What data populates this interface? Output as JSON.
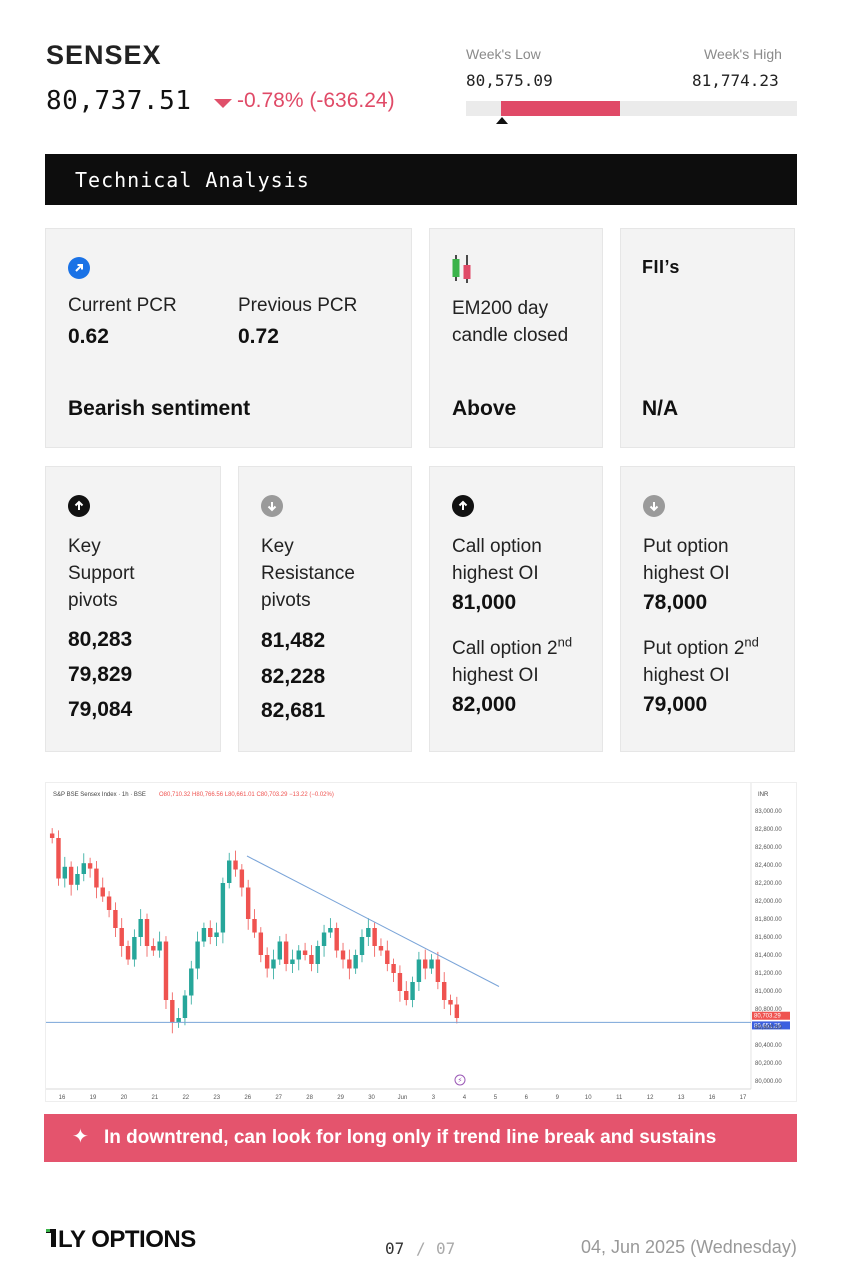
{
  "header": {
    "title": "SENSEX",
    "price": "80,737.51",
    "change_pct": "-0.78%",
    "change_abs": "(-636.24)",
    "week_low_label": "Week's Low",
    "week_low_value": "80,575.09",
    "week_high_label": "Week's High",
    "week_high_value": "81,774.23",
    "week_range_position": 0.11
  },
  "section": {
    "title": "Technical Analysis"
  },
  "pcr_card": {
    "current_label": "Current PCR",
    "current_value": "0.62",
    "previous_label": "Previous PCR",
    "previous_value": "0.72",
    "sentiment": "Bearish sentiment"
  },
  "em_card": {
    "label_line1": "EM200 day",
    "label_line2": "candle closed",
    "value": "Above"
  },
  "fii_card": {
    "label": "FII’s",
    "value": "N/A"
  },
  "support_card": {
    "label_line1": "Key",
    "label_line2": "Support",
    "label_line3": "pivots",
    "values": [
      "80,283",
      "79,829",
      "79,084"
    ]
  },
  "resistance_card": {
    "label_line1": "Key",
    "label_line2": "Resistance",
    "label_line3": "pivots",
    "values": [
      "81,482",
      "82,228",
      "82,681"
    ]
  },
  "call_card": {
    "label_line1": "Call option",
    "label_line2": "highest OI",
    "value": "81,000",
    "second_label_prefix": "Call option 2",
    "second_label_sup": "nd",
    "second_label_line2": "highest OI",
    "second_value": "82,000"
  },
  "put_card": {
    "label_line1": "Put option",
    "label_line2": "highest OI",
    "value": "78,000",
    "second_label_prefix": "Put option 2",
    "second_label_sup": "nd",
    "second_label_line2": "highest OI",
    "second_value": "79,000"
  },
  "chart": {
    "legend_title": "S&P BSE Sensex Index · 1h · BSE",
    "legend_o": "O80,710.32",
    "legend_h": "H80,766.56",
    "legend_l": "L80,661.01",
    "legend_c": "C80,703.29",
    "legend_chg": "−13.22 (−0.02%)",
    "currency": "INR",
    "price_tag_last": "80,703.29",
    "price_tag_line": "80,651.25",
    "up_color": "#26a69a",
    "down_color": "#ef5350",
    "trend_color": "#7aa4d8"
  },
  "chart_data": {
    "type": "candlestick",
    "y_ticks": [
      "83,000.00",
      "82,800.00",
      "82,600.00",
      "82,400.00",
      "82,200.00",
      "82,000.00",
      "81,800.00",
      "81,600.00",
      "81,400.00",
      "81,200.00",
      "81,000.00",
      "80,800.00",
      "80,600.00",
      "80,400.00",
      "80,200.00",
      "80,000.00"
    ],
    "x_ticks": [
      "16",
      "19",
      "20",
      "21",
      "22",
      "23",
      "26",
      "27",
      "28",
      "29",
      "30",
      "Jun",
      "3",
      "4",
      "5",
      "6",
      "9",
      "10",
      "11",
      "12",
      "13",
      "16",
      "17"
    ],
    "ylim": [
      80000,
      83000
    ],
    "trend_line": [
      [
        81.9,
        82500
      ],
      [
        82.6,
        81050
      ]
    ],
    "horizontal_line": 80651,
    "closes": [
      82700,
      82250,
      82380,
      82180,
      82300,
      82420,
      82360,
      82150,
      82050,
      81900,
      81700,
      81500,
      81350,
      81600,
      81800,
      81500,
      81450,
      81550,
      80900,
      80650,
      80700,
      80950,
      81250,
      81550,
      81700,
      81600,
      81650,
      82200,
      82450,
      82350,
      82150,
      81800,
      81650,
      81400,
      81250,
      81350,
      81550,
      81300,
      81350,
      81450,
      81400,
      81300,
      81500,
      81650,
      81700,
      81450,
      81350,
      81250,
      81400,
      81600,
      81700,
      81500,
      81450,
      81300,
      81200,
      81000,
      80900,
      81100,
      81350,
      81250,
      81350,
      81100,
      80900,
      80850,
      80700
    ]
  },
  "banner": {
    "text": "In downtrend, can look for long only if trend line break and sustains"
  },
  "footer": {
    "logo_text": "LY OPTIONS",
    "page_current": "07",
    "page_sep": "/",
    "page_total": "07",
    "date": "04, Jun 2025 (Wednesday)"
  }
}
